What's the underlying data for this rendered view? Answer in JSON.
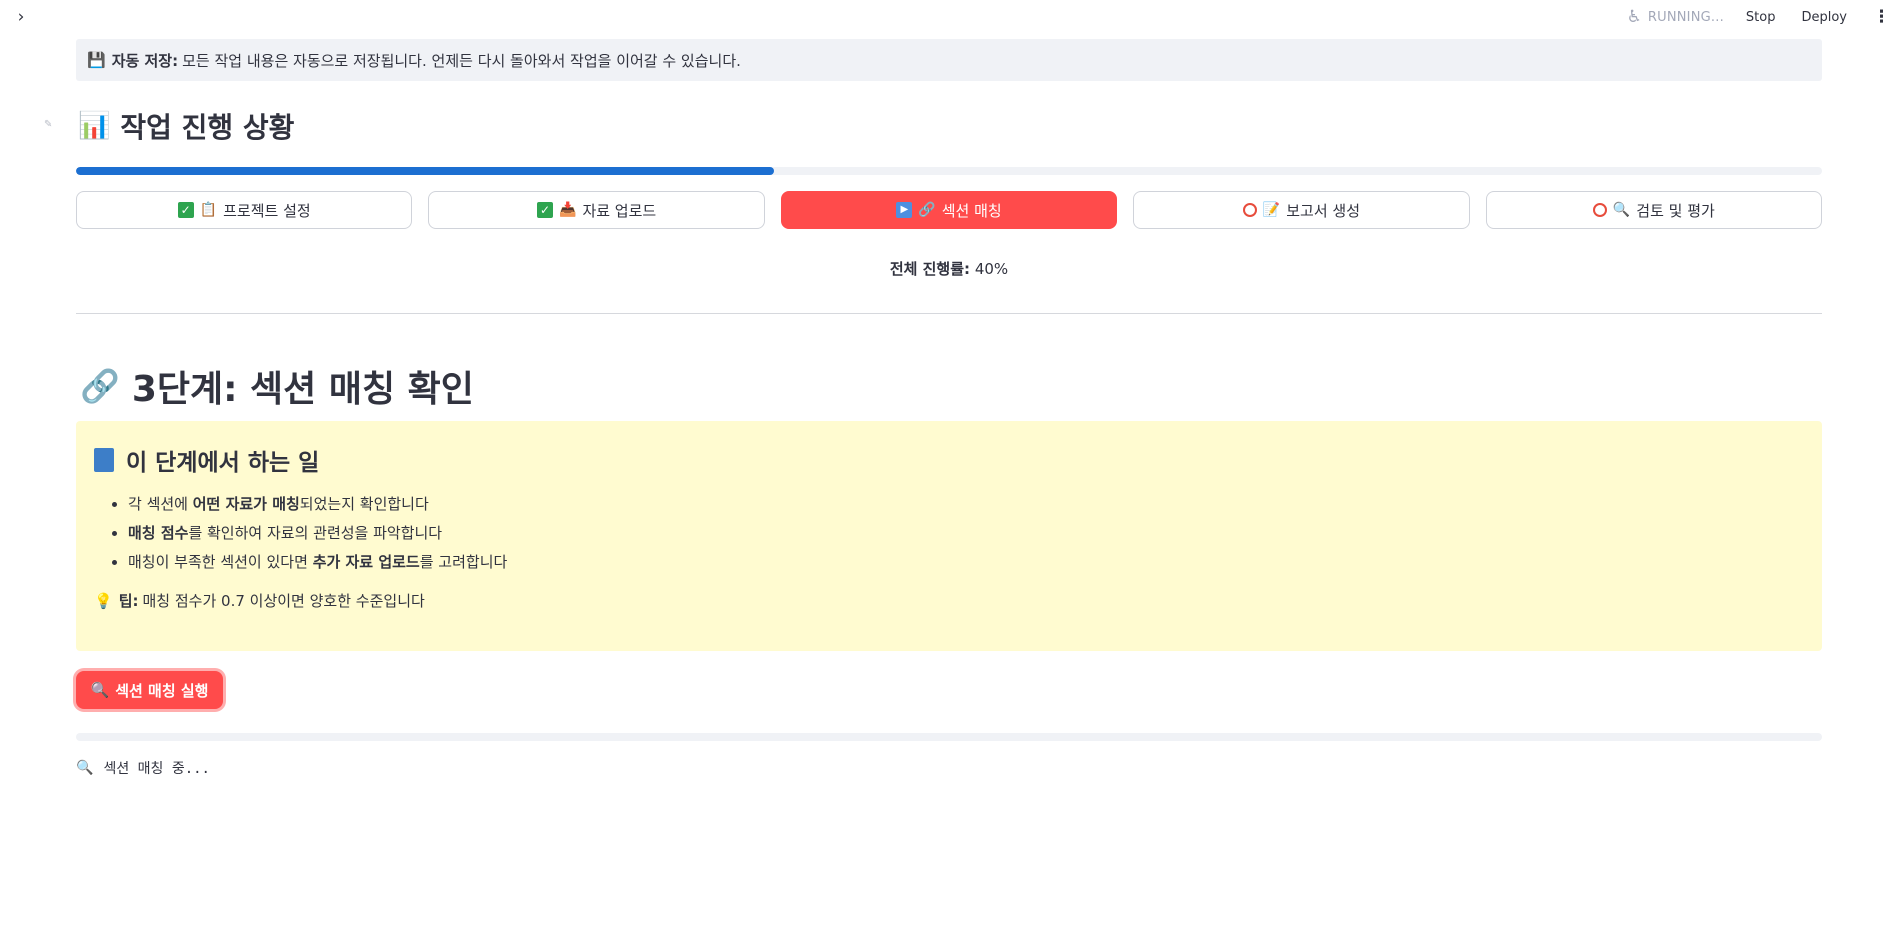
{
  "topbar": {
    "sidebar_toggle_icon": "chevron-right-icon",
    "status_text": "RUNNING...",
    "stop_label": "Stop",
    "deploy_label": "Deploy",
    "menu_icon": "vertical-ellipsis-icon"
  },
  "autosave": {
    "icon": "floppy-disk-icon",
    "label": "자동 저장:",
    "text": "모든 작업 내용은 자동으로 저장됩니다. 언제든 다시 돌아와서 작업을 이어갈 수 있습니다."
  },
  "progress": {
    "title": "작업 진행 상황",
    "icon": "bar-chart-icon",
    "value": 0.4,
    "steps": [
      {
        "status": "done",
        "icon": "clipboard-icon",
        "label": "프로젝트 설정"
      },
      {
        "status": "done",
        "icon": "inbox-tray-icon",
        "label": "자료 업로드"
      },
      {
        "status": "active",
        "icon": "link-icon",
        "label": "섹션 매칭"
      },
      {
        "status": "todo",
        "icon": "memo-icon",
        "label": "보고서 생성"
      },
      {
        "status": "todo",
        "icon": "magnifier-icon",
        "label": "검토 및 평가"
      }
    ],
    "overall_label": "전체 진행률:",
    "overall_value": "40%"
  },
  "step_section": {
    "icon": "link-icon",
    "title": "3단계: 섹션 매칭 확인",
    "info": {
      "icon": "blue-book-icon",
      "title": "이 단계에서 하는 일",
      "bullets": [
        {
          "pre": "각 섹션에 ",
          "bold": "어떤 자료가 매칭",
          "post": "되었는지 확인합니다"
        },
        {
          "pre": "",
          "bold": "매칭 점수",
          "post": "를 확인하여 자료의 관련성을 파악합니다"
        },
        {
          "pre": "매칭이 부족한 섹션이 있다면 ",
          "bold": "추가 자료 업로드",
          "post": "를 고려합니다"
        }
      ],
      "tip_icon": "light-bulb-icon",
      "tip_label": "팁:",
      "tip_text": "매칭 점수가 0.7 이상이면 양호한 수준입니다"
    },
    "run_button": {
      "icon": "magnifier-icon",
      "label": "섹션 매칭 실행"
    },
    "running_message": {
      "icon": "magnifier-icon",
      "text": "섹션 매칭 중..."
    }
  }
}
